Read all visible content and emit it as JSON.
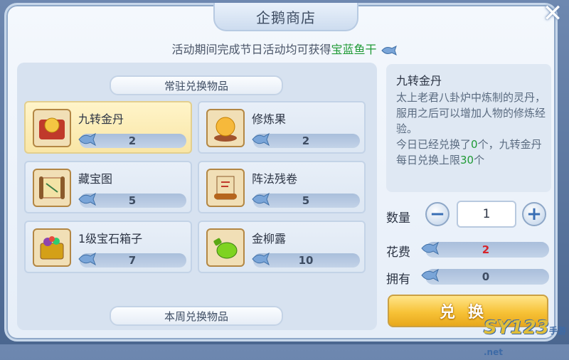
{
  "window": {
    "title": "企鹅商店",
    "close_symbol": "✕"
  },
  "notice": {
    "prefix": "活动期间完成节日活动均可获得",
    "highlight": "宝蓝鱼干"
  },
  "sections": {
    "permanent": "常驻兑换物品",
    "weekly": "本周兑换物品"
  },
  "items": [
    {
      "name": "九转金丹",
      "cost": "2",
      "icon": "golden-pill-icon",
      "selected": true
    },
    {
      "name": "修炼果",
      "cost": "2",
      "icon": "golden-fruit-icon"
    },
    {
      "name": "藏宝图",
      "cost": "5",
      "icon": "treasure-map-icon"
    },
    {
      "name": "阵法残卷",
      "cost": "5",
      "icon": "scroll-icon"
    },
    {
      "name": "1级宝石箱子",
      "cost": "7",
      "icon": "gem-chest-icon"
    },
    {
      "name": "金柳露",
      "cost": "10",
      "icon": "potion-icon"
    }
  ],
  "detail": {
    "title": "九转金丹",
    "desc1": "太上老君八卦炉中炼制的灵丹，服用之后可以增加人物的修炼经验。",
    "desc2_a": "今日已经兑换了",
    "desc2_num": "0",
    "desc2_b": "个，九转金丹每日兑换上限",
    "desc2_limit": "30",
    "desc2_c": "个"
  },
  "controls": {
    "quantity_label": "数量",
    "quantity": "1",
    "minus": "−",
    "plus": "+",
    "cost_label": "花费",
    "cost": "2",
    "own_label": "拥有",
    "own": "0",
    "exchange": "兑换"
  },
  "watermark": {
    "text": "SY123",
    "sub": "手游 .net"
  },
  "colors": {
    "accent_green": "#1f9a35",
    "cost_red": "#d6242b",
    "button_gold": "#f7c237"
  }
}
